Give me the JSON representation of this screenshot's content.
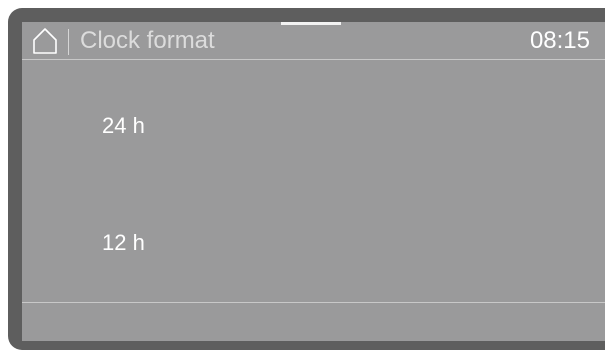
{
  "header": {
    "home_icon": "home-icon",
    "title": "Clock format",
    "time": "08:15"
  },
  "options": [
    {
      "label": "24 h"
    },
    {
      "label": "12 h"
    }
  ],
  "colors": {
    "bezel": "#5e5e5e",
    "screen": "#9a9a9b",
    "text": "#ffffff",
    "title_text": "#dcdcdc",
    "divider": "#c8c8c8"
  }
}
